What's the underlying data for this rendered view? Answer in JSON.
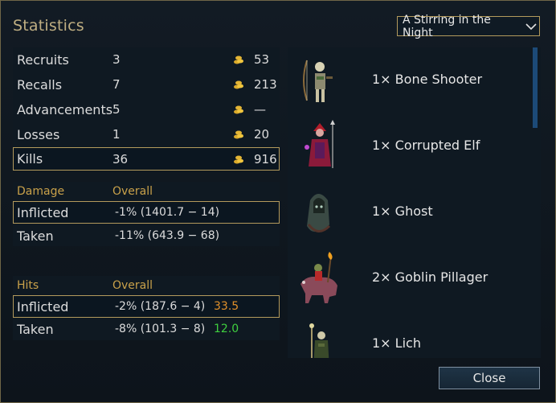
{
  "title": "Statistics",
  "scenario": "A Stirring in the Night",
  "summary": [
    {
      "label": "Recruits",
      "count": "3",
      "gold": "53"
    },
    {
      "label": "Recalls",
      "count": "7",
      "gold": "213"
    },
    {
      "label": "Advancements",
      "count": "5",
      "gold": "—"
    },
    {
      "label": "Losses",
      "count": "1",
      "gold": "20"
    },
    {
      "label": "Kills",
      "count": "36",
      "gold": "916"
    }
  ],
  "damage": {
    "header": "Damage",
    "col": "Overall",
    "inflicted_label": "Inflicted",
    "inflicted_value": "-1% (1401.7 − 14)",
    "taken_label": "Taken",
    "taken_value": "-11% (643.9 − 68)"
  },
  "hits": {
    "header": "Hits",
    "col": "Overall",
    "inflicted_label": "Inflicted",
    "inflicted_value": "-2% (187.6 − 4)",
    "inflicted_extra": "33.5",
    "taken_label": "Taken",
    "taken_value": "-8% (101.3 − 8)",
    "taken_extra": "12.0"
  },
  "units": [
    {
      "name": "1× Bone Shooter",
      "icon": "bone-shooter-portrait"
    },
    {
      "name": "1× Corrupted Elf",
      "icon": "corrupted-elf-portrait"
    },
    {
      "name": "1× Ghost",
      "icon": "ghost-portrait"
    },
    {
      "name": "2× Goblin Pillager",
      "icon": "goblin-pillager-portrait"
    },
    {
      "name": "1× Lich",
      "icon": "lich-portrait"
    }
  ],
  "close_label": "Close",
  "colors": {
    "accent": "#c9a14a",
    "extra_orange": "#e0902a",
    "extra_green": "#3fcf3f",
    "selection_border": "#b39a5c"
  }
}
